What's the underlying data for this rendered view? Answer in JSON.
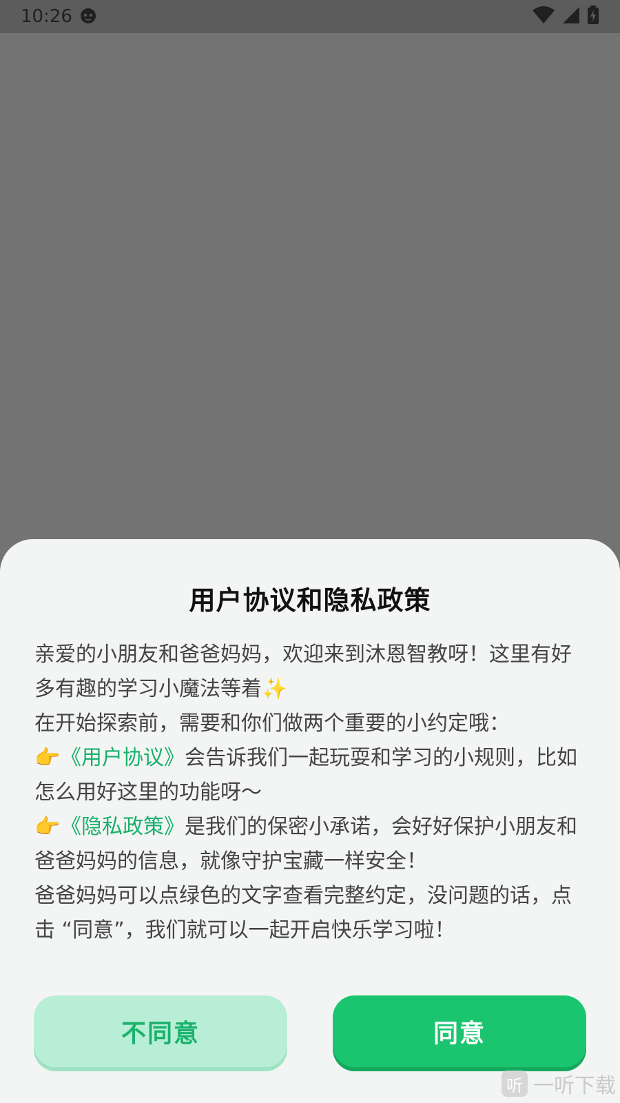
{
  "status_bar": {
    "time": "10:26",
    "icons": [
      "cat-face-icon",
      "wifi-icon",
      "signal-icon",
      "battery-charging-icon"
    ]
  },
  "dialog": {
    "title": "用户协议和隐私政策",
    "paragraph1": "亲爱的小朋友和爸爸妈妈，欢迎来到沐恩智教呀！这里有好多有趣的学习小魔法等着✨",
    "paragraph2": "在开始探索前，需要和你们做两个重要的小约定哦：",
    "item1": {
      "emoji": "👉",
      "link": "《用户协议》",
      "text": "会告诉我们一起玩耍和学习的小规则，比如怎么用好这里的功能呀～"
    },
    "item2": {
      "emoji": "👉",
      "link": "《隐私政策》",
      "text": "是我们的保密小承诺，会好好保护小朋友和爸爸妈妈的信息，就像守护宝藏一样安全！"
    },
    "paragraph3": "爸爸妈妈可以点绿色的文字查看完整约定，没问题的话，点击 “同意”，我们就可以一起开启快乐学习啦！",
    "disagree_label": "不同意",
    "agree_label": "同意"
  },
  "watermark": {
    "icon_text": "听",
    "text": "一听下载"
  },
  "colors": {
    "accent": "#1bc56f",
    "link": "#18b06a",
    "disagree_bg": "#b8eed6",
    "overlay": "#727372"
  }
}
